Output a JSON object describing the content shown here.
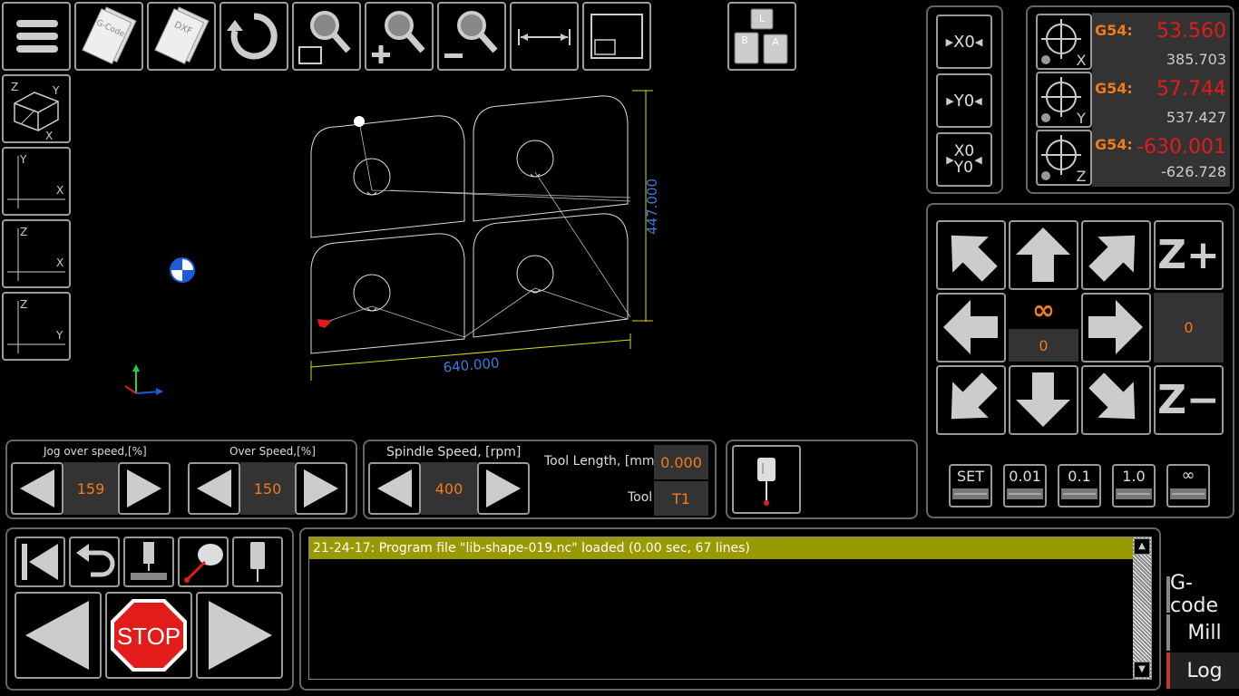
{
  "toolbar": {
    "menu": "menu-icon",
    "gcode": "G-Code",
    "dxf": "DXF",
    "refresh": "refresh-icon",
    "zoom_window": "zoom-window-icon",
    "zoom_in": "zoom-in-icon",
    "zoom_out": "zoom-out-icon",
    "fit_width": "fit-width-icon",
    "fit_view": "fit-view-icon",
    "keyboard": [
      "L",
      "B",
      "A"
    ]
  },
  "views": [
    {
      "name": "iso",
      "a": "Z",
      "b": "Y",
      "c": "X"
    },
    {
      "name": "xy",
      "a": "Y",
      "b": "X"
    },
    {
      "name": "xz",
      "a": "Z",
      "b": "X"
    },
    {
      "name": "yz",
      "a": "Z",
      "b": "Y"
    }
  ],
  "canvas": {
    "dim_width": "640.000",
    "dim_height": "447.000"
  },
  "zero_buttons": {
    "x0": "X0",
    "y0": "Y0",
    "xy0_a": "X0",
    "xy0_b": "Y0"
  },
  "dro": [
    {
      "axis": "X",
      "wcs": "G54:",
      "work": "53.560",
      "machine": "385.703"
    },
    {
      "axis": "Y",
      "wcs": "G54:",
      "work": "57.744",
      "machine": "537.427"
    },
    {
      "axis": "Z",
      "wcs": "G54:",
      "work": "-630.001",
      "machine": "-626.728"
    }
  ],
  "jog": {
    "z_plus": "Z+",
    "z_minus": "Z−",
    "infinity": "∞",
    "step_value": "0",
    "z_value": "0"
  },
  "steps": [
    "SET",
    "0.01",
    "0.1",
    "1.0",
    "∞"
  ],
  "speeds": {
    "jog_label": "Jog over speed,[%]",
    "jog_value": "159",
    "over_label": "Over Speed,[%]",
    "over_value": "150",
    "spindle_label": "Spindle Speed, [rpm]",
    "spindle_value": "400",
    "tool_length_label": "Tool Length, [mm]",
    "tool_length_value": "0.000",
    "tool_label": "Tool",
    "tool_value": "T1"
  },
  "run": {
    "stop": "STOP"
  },
  "log": {
    "message": "21-24-17: Program file \"lib-shape-019.nc\" loaded (0.00 sec, 67 lines)"
  },
  "tabs": [
    "G-code",
    "Mill",
    "Log"
  ],
  "colors": {
    "accent": "#f07a1c",
    "red": "#e21b1b",
    "log_bar": "#999900",
    "dim": "#3b7be0"
  }
}
